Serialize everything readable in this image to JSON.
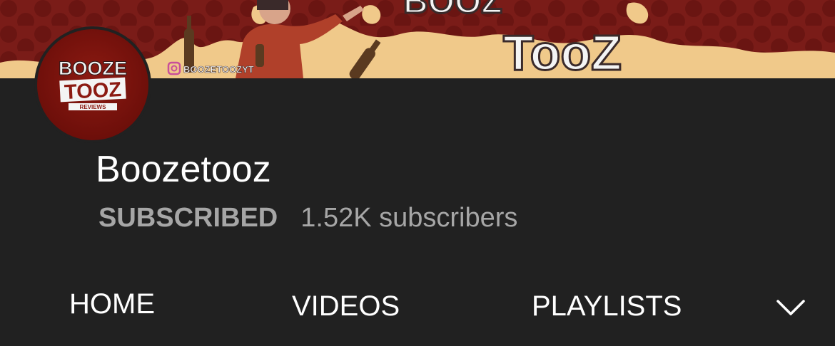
{
  "banner": {
    "title_lines": [
      "BOOZ",
      "TooZ"
    ],
    "instagram_handle": "BOOZETOOZYT",
    "colors": {
      "background": "#7a1c18",
      "wave": "#f0c98a",
      "title_fill": "#f4f4f4",
      "title_outline": "#3a2a2a"
    }
  },
  "avatar": {
    "logo_lines": [
      "BOOZE",
      "TOOZ"
    ],
    "logo_sub": "REVIEWS",
    "background": "#6e0f0a"
  },
  "channel": {
    "name": "Boozetooz",
    "subscribe_status": "SUBSCRIBED",
    "subscriber_count": "1.52K subscribers"
  },
  "tabs": {
    "items": [
      {
        "label": "HOME"
      },
      {
        "label": "VIDEOS"
      },
      {
        "label": "PLAYLISTS"
      }
    ],
    "more_icon": "chevron-down-icon"
  }
}
